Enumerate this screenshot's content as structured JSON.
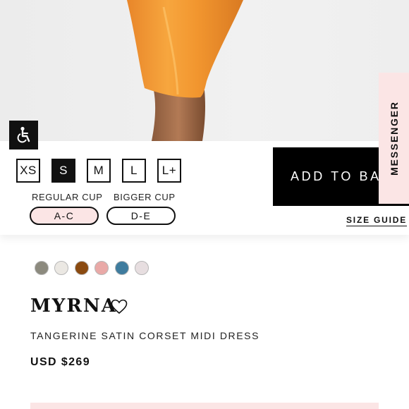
{
  "sizes": [
    "XS",
    "S",
    "M",
    "L",
    "L+"
  ],
  "selected_size": "S",
  "cups": {
    "regular_label": "REGULAR CUP",
    "regular_value": "A-C",
    "bigger_label": "BIGGER CUP",
    "bigger_value": "D-E",
    "selected": "A-C"
  },
  "add_to_bag_label": "ADD TO BA",
  "messenger_label": "MESSENGER",
  "size_guide_label": "SIZE GUIDE",
  "color_swatches": [
    "#8c8a7e",
    "#ebe8e3",
    "#8a4a10",
    "#e9a9a7",
    "#3f7c9e",
    "#e7dee0"
  ],
  "product": {
    "name": "MYRNA",
    "description": "TANGERINE SATIN CORSET MIDI DRESS",
    "price": "USD $269"
  },
  "colors": {
    "accent_pink": "#fbe5e5",
    "black": "#000000",
    "dress_orange": "#f29a33"
  },
  "icons": [
    "accessibility-icon",
    "heart-icon"
  ]
}
